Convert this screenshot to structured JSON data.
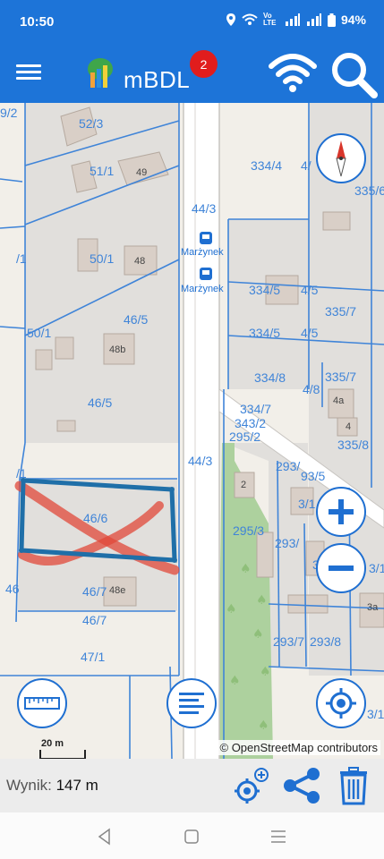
{
  "status": {
    "time": "10:50",
    "network_label": "Vo LTE",
    "battery": "94%"
  },
  "app": {
    "title": "mBDL",
    "notification_count": "2"
  },
  "map": {
    "parcels": [
      {
        "label": "9/2"
      },
      {
        "label": "52/3"
      },
      {
        "label": "51/1"
      },
      {
        "label": "44/3"
      },
      {
        "label": "334/4"
      },
      {
        "label": "4/"
      },
      {
        "label": "335/6"
      },
      {
        "label": "/1"
      },
      {
        "label": "50/1"
      },
      {
        "label": "334/5"
      },
      {
        "label": "4/5"
      },
      {
        "label": "335/7"
      },
      {
        "label": "46/5"
      },
      {
        "label": "50/1"
      },
      {
        "label": "334/5"
      },
      {
        "label": "4/5"
      },
      {
        "label": "334/8"
      },
      {
        "label": "4/8"
      },
      {
        "label": "335/7"
      },
      {
        "label": "46/5"
      },
      {
        "label": "334/7"
      },
      {
        "label": "343/2"
      },
      {
        "label": "295/2"
      },
      {
        "label": "335/8"
      },
      {
        "label": "44/3"
      },
      {
        "label": "293/"
      },
      {
        "label": "93/5"
      },
      {
        "label": "/1"
      },
      {
        "label": "46/6"
      },
      {
        "label": "295/3"
      },
      {
        "label": "293/"
      },
      {
        "label": "3/1"
      },
      {
        "label": "46/7"
      },
      {
        "label": "46/7"
      },
      {
        "label": "293/7"
      },
      {
        "label": "293/8"
      },
      {
        "label": "47/1"
      },
      {
        "label": "3/1"
      },
      {
        "label": "46"
      },
      {
        "label": "3/1"
      },
      {
        "label": "3"
      }
    ],
    "buildings": [
      {
        "label": "49"
      },
      {
        "label": "48"
      },
      {
        "label": "48b"
      },
      {
        "label": "4a"
      },
      {
        "label": "4"
      },
      {
        "label": "2"
      },
      {
        "label": "48e"
      },
      {
        "label": "3a"
      }
    ],
    "bus_stops": [
      {
        "label": "Marżynek"
      },
      {
        "label": "Marżynek"
      }
    ],
    "attribution": "© OpenStreetMap contributors",
    "scale_label": "20 m"
  },
  "measurement": {
    "label": "Wynik:",
    "value": "147 m"
  },
  "icons": {
    "menu": "menu-icon",
    "wifi": "wifi-icon",
    "search": "search-icon",
    "compass": "compass-icon",
    "zoom_in": "plus-icon",
    "zoom_out": "minus-icon",
    "ruler": "ruler-icon",
    "legend": "list-icon",
    "locate": "target-icon",
    "add_point": "add-location-icon",
    "share": "share-icon",
    "delete": "trash-icon"
  },
  "colors": {
    "accent": "#1d74d8",
    "parcel_line": "#3f84d8",
    "selection": "#1f6fa8",
    "cross": "#e0483a",
    "badge": "#e11d1d",
    "green_area": "#add19e"
  }
}
